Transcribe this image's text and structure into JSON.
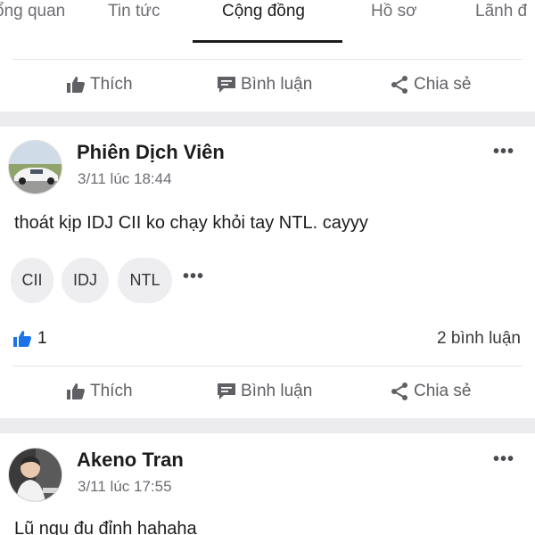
{
  "tabs": [
    {
      "label": "ổng quan"
    },
    {
      "label": "Tin tức"
    },
    {
      "label": "Cộng đồng"
    },
    {
      "label": "Hồ sơ"
    },
    {
      "label": "Lãnh đ"
    }
  ],
  "actions": {
    "like": "Thích",
    "comment": "Bình luận",
    "share": "Chia sẻ"
  },
  "posts": [
    {
      "author": "Phiên Dịch Viên",
      "time": "3/11 lúc 18:44",
      "text": "thoát kịp IDJ CII ko chạy khỏi tay NTL. cayyy",
      "tags": [
        "CII",
        "IDJ",
        "NTL"
      ],
      "likes": "1",
      "comments": "2 bình luận"
    },
    {
      "author": "Akeno Tran",
      "time": "3/11 lúc 17:55",
      "text": "Lũ ngu đu đỉnh hahaha"
    }
  ],
  "more_glyph": "•••",
  "colors": {
    "accent_blue": "#1a73e8",
    "divider_band": "#ececee",
    "active_tab": "#1c1c1e"
  },
  "icons": [
    "thumbs-up-icon",
    "comment-icon",
    "share-icon",
    "more-icon"
  ]
}
